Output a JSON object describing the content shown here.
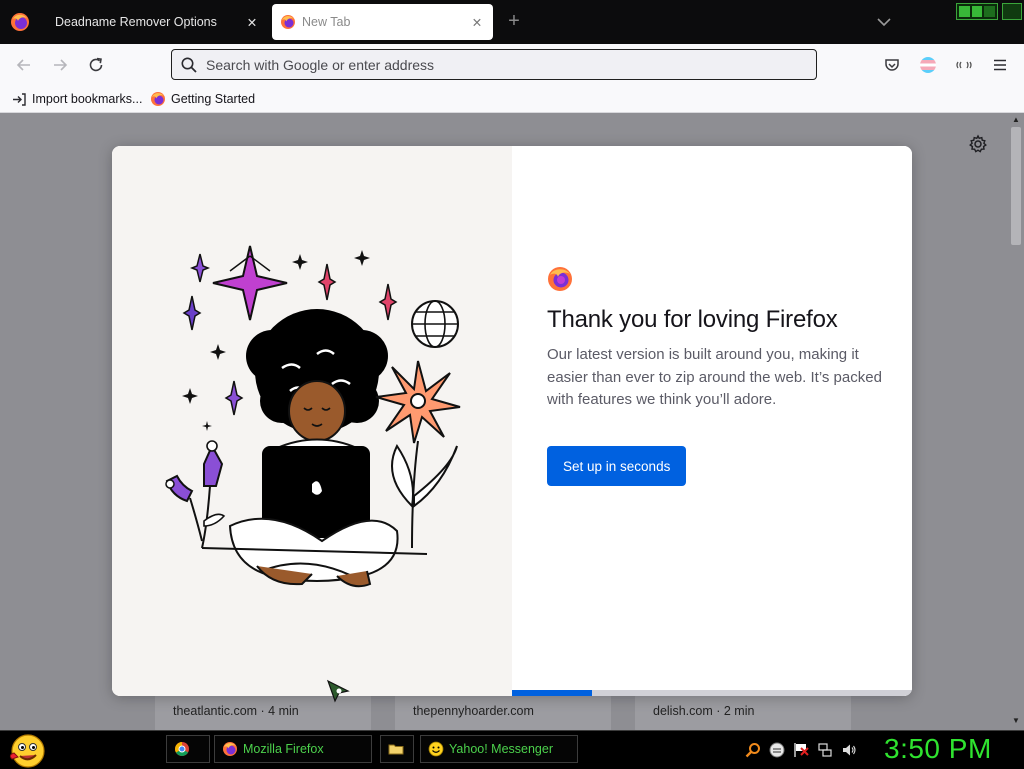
{
  "browser": {
    "tabs": [
      {
        "title": "Deadname Remover Options",
        "active": false
      },
      {
        "title": "New Tab",
        "active": true
      }
    ],
    "new_tab_symbol": "+",
    "close_symbol": "✕"
  },
  "navbar": {
    "url_placeholder": "Search with Google or enter address"
  },
  "bookmarks": [
    {
      "label": "Import bookmarks...",
      "icon": "import-icon"
    },
    {
      "label": "Getting Started",
      "icon": "firefox-icon"
    }
  ],
  "newtab": {
    "stories": [
      {
        "meta": "theatlantic.com · 4 min"
      },
      {
        "meta": "thepennyhoarder.com"
      },
      {
        "meta": "delish.com · 2 min"
      }
    ]
  },
  "modal": {
    "title": "Thank you for loving Firefox",
    "body": "Our latest version is built around you, making it easier than ever to zip around the web. It’s packed with features we think you’ll adore.",
    "primary_button": "Set up in seconds",
    "progress": 0.2
  },
  "taskbar": {
    "buttons": [
      {
        "label": "",
        "icon": "chrome-icon"
      },
      {
        "label": "Mozilla Firefox",
        "icon": "firefox-icon"
      },
      {
        "label": "",
        "icon": "folder-icon"
      },
      {
        "label": "Yahoo! Messenger",
        "icon": "yahoo-smiley-icon"
      }
    ],
    "clock": "3:50 PM"
  },
  "colors": {
    "accent": "#0061e0",
    "taskbar_text": "#4cd14c",
    "clock": "#2fe32f",
    "backdrop": "#8e8e93"
  }
}
